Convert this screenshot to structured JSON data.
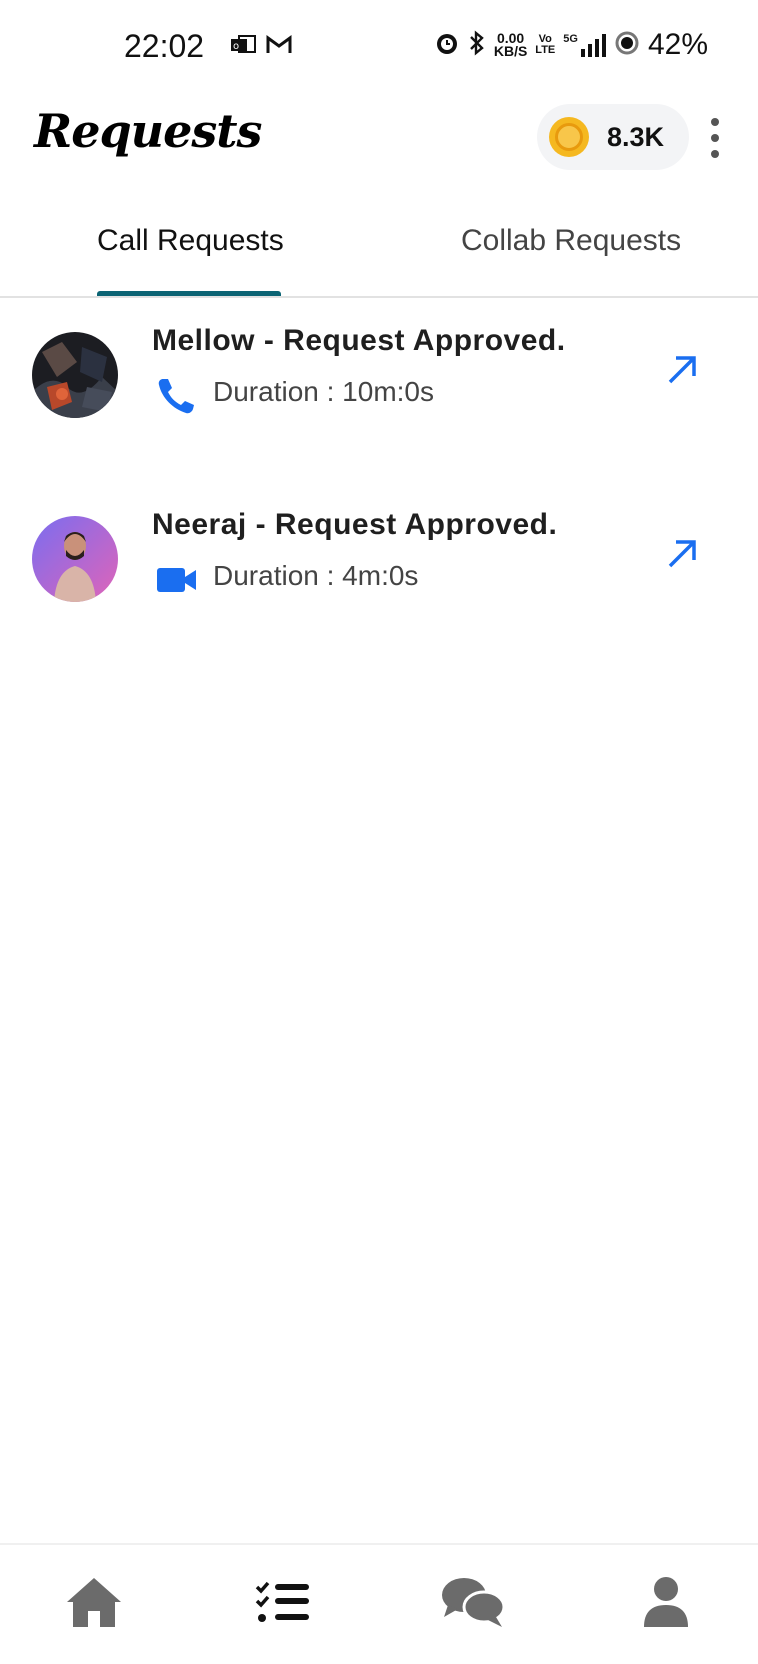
{
  "status_bar": {
    "time": "22:02",
    "net_speed_value": "0.00",
    "net_speed_unit": "KB/S",
    "volte_top": "Vo",
    "volte_bottom": "LTE",
    "network": "5G",
    "battery": "42%",
    "icons": [
      "email-icon",
      "gmail-icon",
      "alarm-icon",
      "bluetooth-icon",
      "signal-icon",
      "battery-saver-icon"
    ]
  },
  "header": {
    "title": "Requests",
    "coins": "8.3K"
  },
  "tabs": [
    {
      "label": "Call Requests",
      "active": true
    },
    {
      "label": "Collab Requests",
      "active": false
    }
  ],
  "requests": [
    {
      "title": "Mellow - Request Approved.",
      "type_icon": "phone-icon",
      "duration": "Duration : 10m:0s"
    },
    {
      "title": "Neeraj - Request Approved.",
      "type_icon": "video-icon",
      "duration": "Duration : 4m:0s"
    }
  ],
  "bottom_nav": [
    {
      "icon": "home-icon"
    },
    {
      "icon": "checklist-icon",
      "active": true
    },
    {
      "icon": "chat-icon"
    },
    {
      "icon": "profile-icon"
    }
  ],
  "colors": {
    "accent": "#1a6ef0",
    "tab_indicator": "#0b6474",
    "nav_icon": "#6b6b6b",
    "nav_active": "#111111"
  }
}
